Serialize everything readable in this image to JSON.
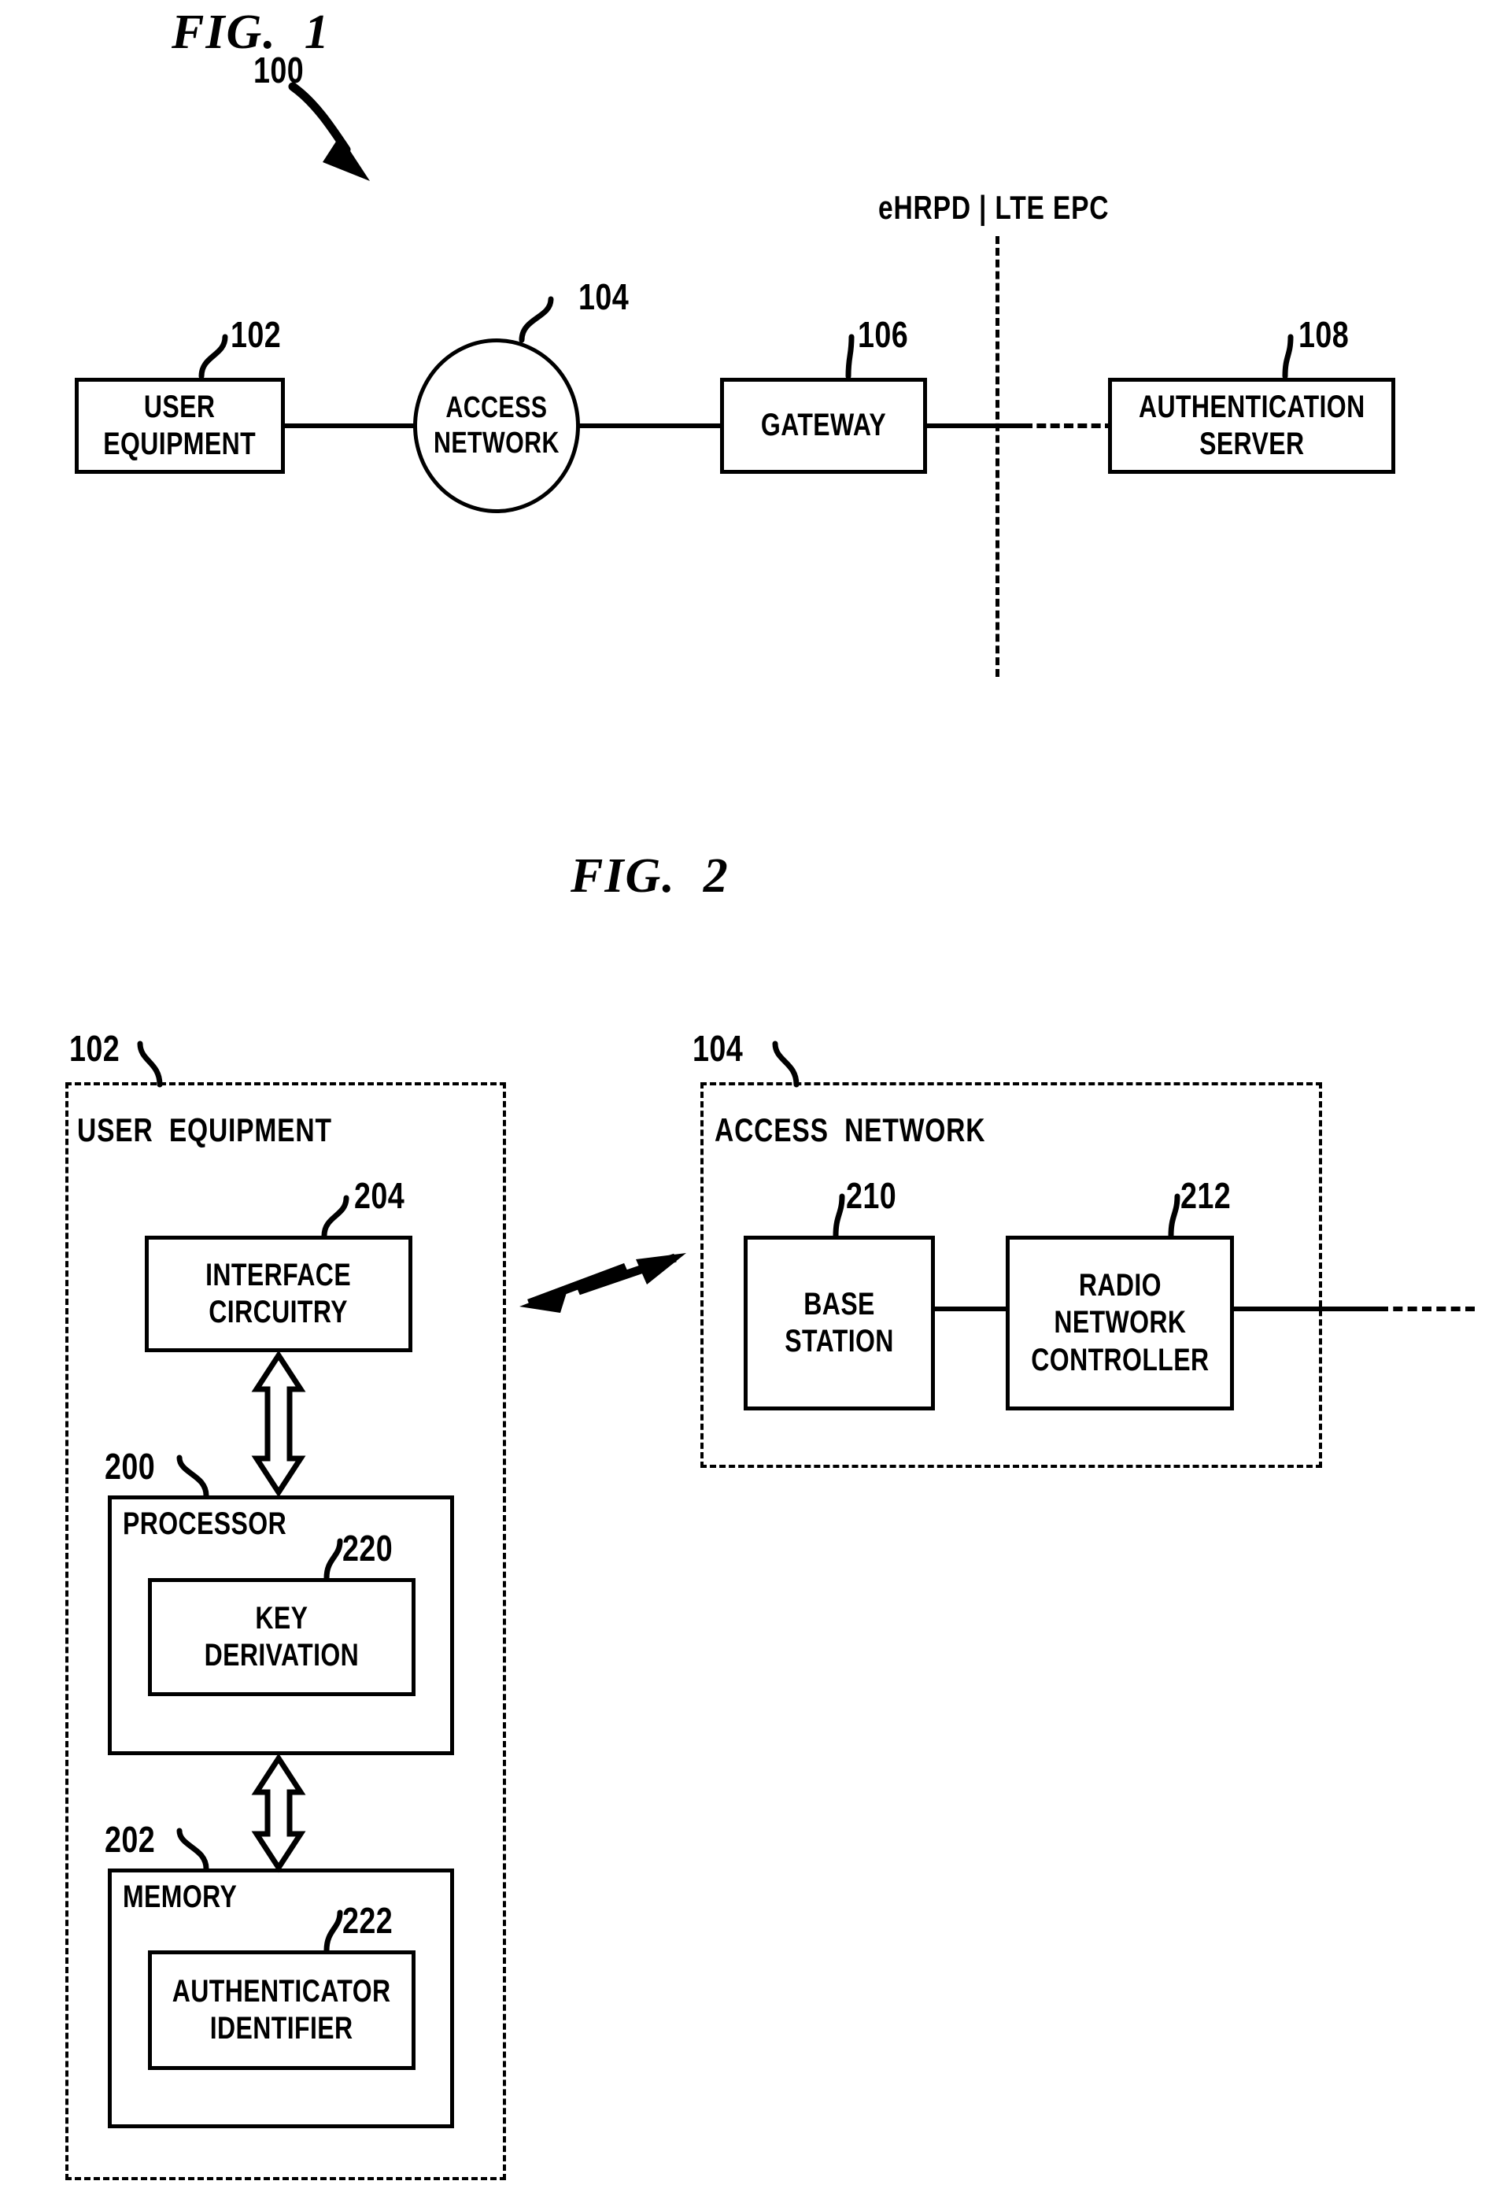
{
  "figure1": {
    "title": "FIG.  1",
    "system_ref": "100",
    "divider_label": "eHRPD | LTE EPC",
    "nodes": [
      {
        "id": "user-equipment",
        "label": "USER\nEQUIPMENT",
        "ref": "102",
        "shape": "rect"
      },
      {
        "id": "access-network",
        "label": "ACCESS\nNETWORK",
        "ref": "104",
        "shape": "ellipse"
      },
      {
        "id": "gateway",
        "label": "GATEWAY",
        "ref": "106",
        "shape": "rect"
      },
      {
        "id": "authentication-server",
        "label": "AUTHENTICATION\nSERVER",
        "ref": "108",
        "shape": "rect"
      }
    ]
  },
  "figure2": {
    "title": "FIG.  2",
    "user_equipment": {
      "title": "USER  EQUIPMENT",
      "ref": "102",
      "blocks": [
        {
          "id": "interface-circuitry",
          "label": "INTERFACE\nCIRCUITRY",
          "ref": "204"
        },
        {
          "id": "processor",
          "label": "PROCESSOR",
          "ref": "200"
        },
        {
          "id": "key-derivation",
          "label": "KEY\nDERIVATION",
          "ref": "220"
        },
        {
          "id": "memory",
          "label": "MEMORY",
          "ref": "202"
        },
        {
          "id": "authenticator-identifier",
          "label": "AUTHENTICATOR\nIDENTIFIER",
          "ref": "222"
        }
      ]
    },
    "access_network": {
      "title": "ACCESS  NETWORK",
      "ref": "104",
      "blocks": [
        {
          "id": "base-station",
          "label": "BASE\nSTATION",
          "ref": "210"
        },
        {
          "id": "radio-network-controller",
          "label": "RADIO\nNETWORK\nCONTROLLER",
          "ref": "212"
        }
      ]
    }
  },
  "colors": {
    "ink": "#000000",
    "paper": "#ffffff"
  }
}
